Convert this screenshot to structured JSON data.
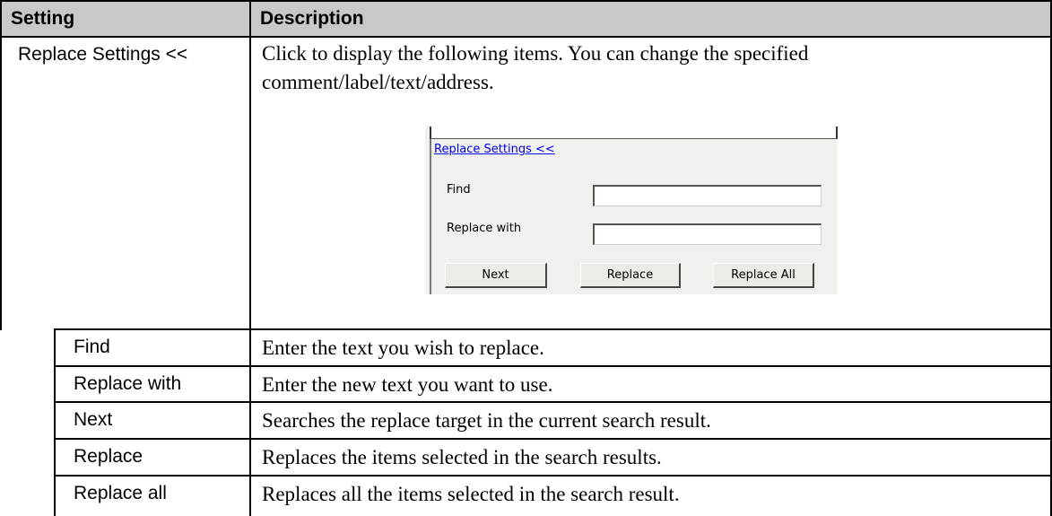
{
  "table": {
    "headers": {
      "setting": "Setting",
      "description": "Description"
    },
    "main_row": {
      "setting": "Replace Settings <<",
      "description": "Click to display the following items. You can change the specified comment/label/text/address."
    },
    "sub_rows": [
      {
        "setting": "Find",
        "description": "Enter the text you wish to replace."
      },
      {
        "setting": "Replace with",
        "description": "Enter the new text you want to use."
      },
      {
        "setting": "Next",
        "description": "Searches the replace target in the current search result."
      },
      {
        "setting": "Replace",
        "description": "Replaces the items selected in the search results."
      },
      {
        "setting": "Replace all",
        "description": "Replaces all the items selected in the search result."
      }
    ]
  },
  "dialog": {
    "link": "Replace Settings <<",
    "find_label": "Find",
    "find_value": "",
    "replace_label": "Replace with",
    "replace_value": "",
    "buttons": {
      "next": "Next",
      "replace": "Replace",
      "replace_all": "Replace All"
    }
  }
}
